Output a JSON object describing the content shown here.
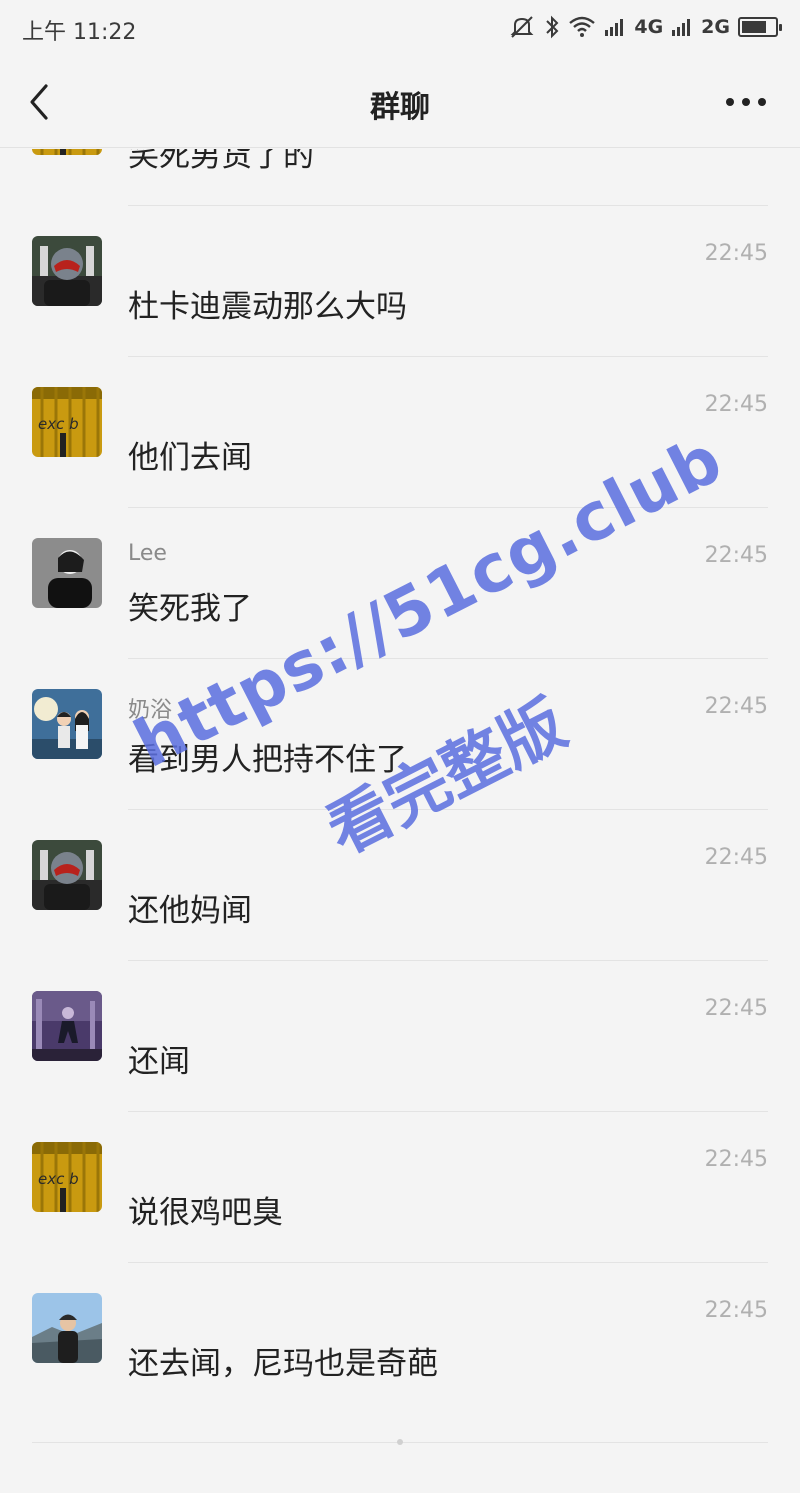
{
  "status_bar": {
    "time": "上午 11:22",
    "network_1": "4G",
    "network_2": "2G",
    "battery_level": 0.75
  },
  "nav": {
    "title": "群聊",
    "back_icon": "chevron-left-icon",
    "more_icon": "more-dots-icon"
  },
  "messages": [
    {
      "sender": "",
      "text": "笑死男货了的",
      "time": "",
      "avatar": "yellow-club-avatar"
    },
    {
      "sender": "",
      "text": "杜卡迪震动那么大吗",
      "time": "22:45",
      "avatar": "helmet-avatar"
    },
    {
      "sender": "",
      "text": "他们去闻",
      "time": "22:45",
      "avatar": "yellow-club-avatar"
    },
    {
      "sender": "Lee",
      "text": "笑死我了",
      "time": "22:45",
      "avatar": "gray-portrait-avatar"
    },
    {
      "sender": "奶浴",
      "text": "看到男人把持不住了",
      "time": "22:45",
      "avatar": "couple-moon-avatar"
    },
    {
      "sender": "",
      "text": "还他妈闻",
      "time": "22:45",
      "avatar": "helmet-avatar"
    },
    {
      "sender": "",
      "text": "还闻",
      "time": "22:45",
      "avatar": "purple-night-avatar"
    },
    {
      "sender": "",
      "text": "说很鸡吧臭",
      "time": "22:45",
      "avatar": "yellow-club-avatar"
    },
    {
      "sender": "",
      "text": "还去闻，尼玛也是奇葩",
      "time": "22:45",
      "avatar": "sky-portrait-avatar"
    }
  ],
  "watermark": {
    "url": "https://51cg.club",
    "caption": "看完整版"
  },
  "colors": {
    "background": "#f4f4f4",
    "text": "#222222",
    "time": "#b0b0b0",
    "watermark": "#5b6fe0"
  }
}
